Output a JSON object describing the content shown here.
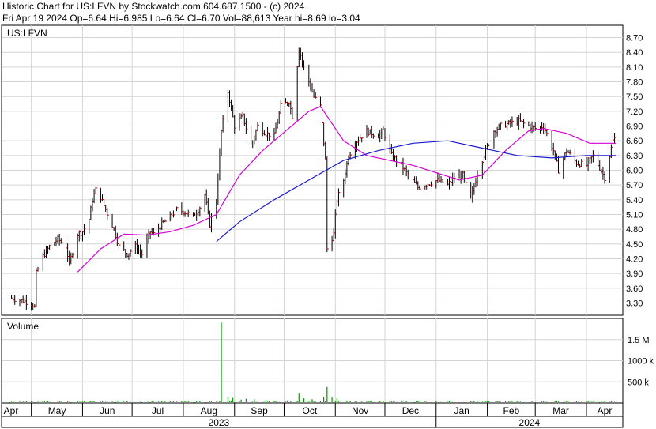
{
  "header": {
    "line1": "Historic Chart for US:LFVN by Stockwatch.com 604.687.1500 - (c) 2024",
    "line2": "Fri Apr 19 2024   Op=6.64   Hi=6.985   Lo=6.64   Cl=6.70   Vol=88,613   Year hi=8.69   lo=3.04"
  },
  "chart_data": [
    {
      "type": "line",
      "title": "US:LFVN",
      "price_axis": {
        "ticks": [
          "8.70",
          "8.40",
          "8.10",
          "7.80",
          "7.50",
          "7.20",
          "6.90",
          "6.60",
          "6.30",
          "6.00",
          "5.70",
          "5.40",
          "5.10",
          "4.80",
          "4.50",
          "4.20",
          "3.90",
          "3.60",
          "3.30"
        ],
        "ylim": [
          3.05,
          8.95
        ],
        "grid": true
      },
      "x_axis": {
        "months": [
          "Apr",
          "May",
          "Jun",
          "Jul",
          "Aug",
          "Sep",
          "Oct",
          "Nov",
          "Dec",
          "Jan",
          "Feb",
          "Mar",
          "Apr"
        ],
        "years": [
          "2023",
          "2024"
        ]
      },
      "series": [
        {
          "name": "Price",
          "style": "OHLC bars",
          "color": "#000000",
          "close_tick_color": "#cc0000",
          "points": [
            [
              "2023-04-19",
              3.4
            ],
            [
              "2023-04-26",
              3.34
            ],
            [
              "2023-05-01",
              3.3
            ],
            [
              "2023-05-03",
              3.22
            ],
            [
              "2023-05-04",
              3.9
            ],
            [
              "2023-05-08",
              4.25
            ],
            [
              "2023-05-12",
              4.45
            ],
            [
              "2023-05-17",
              4.6
            ],
            [
              "2023-05-22",
              4.45
            ],
            [
              "2023-05-24",
              4.1
            ],
            [
              "2023-05-29",
              4.7
            ],
            [
              "2023-06-01",
              4.75
            ],
            [
              "2023-06-05",
              5.0
            ],
            [
              "2023-06-07",
              5.4
            ],
            [
              "2023-06-09",
              5.6
            ],
            [
              "2023-06-12",
              5.45
            ],
            [
              "2023-06-15",
              5.2
            ],
            [
              "2023-06-20",
              4.8
            ],
            [
              "2023-06-23",
              4.45
            ],
            [
              "2023-06-28",
              4.3
            ],
            [
              "2023-07-03",
              4.45
            ],
            [
              "2023-07-07",
              4.3
            ],
            [
              "2023-07-12",
              4.75
            ],
            [
              "2023-07-14",
              4.7
            ],
            [
              "2023-07-19",
              4.9
            ],
            [
              "2023-07-24",
              5.05
            ],
            [
              "2023-07-28",
              5.2
            ],
            [
              "2023-08-02",
              5.15
            ],
            [
              "2023-08-07",
              5.05
            ],
            [
              "2023-08-11",
              5.25
            ],
            [
              "2023-08-14",
              5.5
            ],
            [
              "2023-08-17",
              4.9
            ],
            [
              "2023-08-21",
              5.4
            ],
            [
              "2023-08-24",
              6.8
            ],
            [
              "2023-08-28",
              7.6
            ],
            [
              "2023-09-01",
              6.9
            ],
            [
              "2023-09-06",
              7.1
            ],
            [
              "2023-09-11",
              6.5
            ],
            [
              "2023-09-15",
              6.9
            ],
            [
              "2023-09-20",
              6.75
            ],
            [
              "2023-09-25",
              6.7
            ],
            [
              "2023-09-29",
              7.3
            ],
            [
              "2023-10-04",
              7.4
            ],
            [
              "2023-10-06",
              7.1
            ],
            [
              "2023-10-10",
              8.5
            ],
            [
              "2023-10-12",
              8.2
            ],
            [
              "2023-10-16",
              7.8
            ],
            [
              "2023-10-19",
              7.5
            ],
            [
              "2023-10-23",
              7.3
            ],
            [
              "2023-10-26",
              6.2
            ],
            [
              "2023-10-27",
              4.4
            ],
            [
              "2023-10-31",
              4.7
            ],
            [
              "2023-11-02",
              5.4
            ],
            [
              "2023-11-06",
              5.8
            ],
            [
              "2023-11-09",
              6.3
            ],
            [
              "2023-11-14",
              6.6
            ],
            [
              "2023-11-20",
              6.8
            ],
            [
              "2023-11-27",
              6.7
            ],
            [
              "2023-11-30",
              6.8
            ],
            [
              "2023-12-05",
              6.3
            ],
            [
              "2023-12-11",
              6.1
            ],
            [
              "2023-12-15",
              5.9
            ],
            [
              "2023-12-21",
              5.65
            ],
            [
              "2024-01-02",
              5.8
            ],
            [
              "2024-01-08",
              5.7
            ],
            [
              "2024-01-12",
              5.85
            ],
            [
              "2024-01-17",
              5.9
            ],
            [
              "2024-01-22",
              5.4
            ],
            [
              "2024-01-26",
              5.95
            ],
            [
              "2024-01-31",
              6.4
            ],
            [
              "2024-02-05",
              6.8
            ],
            [
              "2024-02-09",
              6.9
            ],
            [
              "2024-02-14",
              6.95
            ],
            [
              "2024-02-20",
              7.0
            ],
            [
              "2024-02-26",
              6.9
            ],
            [
              "2024-03-01",
              6.85
            ],
            [
              "2024-03-06",
              6.9
            ],
            [
              "2024-03-12",
              6.4
            ],
            [
              "2024-03-15",
              6.0
            ],
            [
              "2024-03-20",
              6.4
            ],
            [
              "2024-03-26",
              6.15
            ],
            [
              "2024-04-01",
              6.1
            ],
            [
              "2024-04-05",
              6.3
            ],
            [
              "2024-04-09",
              6.05
            ],
            [
              "2024-04-12",
              5.85
            ],
            [
              "2024-04-17",
              6.6
            ],
            [
              "2024-04-19",
              6.7
            ]
          ]
        },
        {
          "name": "MA short",
          "color": "#d400d4",
          "points": [
            [
              "2023-05-29",
              3.93
            ],
            [
              "2023-06-12",
              4.4
            ],
            [
              "2023-06-26",
              4.7
            ],
            [
              "2023-07-10",
              4.68
            ],
            [
              "2023-07-24",
              4.75
            ],
            [
              "2023-08-07",
              4.88
            ],
            [
              "2023-08-21",
              5.1
            ],
            [
              "2023-09-04",
              5.9
            ],
            [
              "2023-09-18",
              6.4
            ],
            [
              "2023-10-02",
              6.8
            ],
            [
              "2023-10-16",
              7.2
            ],
            [
              "2023-10-23",
              7.3
            ],
            [
              "2023-11-06",
              6.6
            ],
            [
              "2023-11-20",
              6.3
            ],
            [
              "2023-12-04",
              6.2
            ],
            [
              "2023-12-18",
              6.1
            ],
            [
              "2024-01-01",
              5.95
            ],
            [
              "2024-01-15",
              5.8
            ],
            [
              "2024-01-29",
              5.9
            ],
            [
              "2024-02-12",
              6.4
            ],
            [
              "2024-02-26",
              6.8
            ],
            [
              "2024-03-06",
              6.85
            ],
            [
              "2024-03-20",
              6.75
            ],
            [
              "2024-04-03",
              6.55
            ],
            [
              "2024-04-19",
              6.55
            ]
          ]
        },
        {
          "name": "MA long",
          "color": "#1a1ad0",
          "points": [
            [
              "2023-08-21",
              4.55
            ],
            [
              "2023-09-04",
              4.95
            ],
            [
              "2023-09-25",
              5.4
            ],
            [
              "2023-10-16",
              5.8
            ],
            [
              "2023-11-06",
              6.2
            ],
            [
              "2023-11-27",
              6.4
            ],
            [
              "2023-12-18",
              6.55
            ],
            [
              "2024-01-08",
              6.6
            ],
            [
              "2024-01-29",
              6.45
            ],
            [
              "2024-02-19",
              6.3
            ],
            [
              "2024-03-11",
              6.25
            ],
            [
              "2024-04-01",
              6.3
            ],
            [
              "2024-04-19",
              6.3
            ]
          ]
        }
      ]
    },
    {
      "type": "bar",
      "title": "Volume",
      "y_ticks": [
        "1.5 M",
        "1000 k",
        "500 k"
      ],
      "ylim": [
        0,
        2000000
      ],
      "color": "#009900",
      "bars": [
        [
          "2023-04-21",
          25000
        ],
        [
          "2023-05-05",
          30000
        ],
        [
          "2023-05-19",
          28000
        ],
        [
          "2023-06-02",
          35000
        ],
        [
          "2023-06-16",
          30000
        ],
        [
          "2023-06-30",
          25000
        ],
        [
          "2023-07-14",
          27000
        ],
        [
          "2023-07-28",
          30000
        ],
        [
          "2023-08-11",
          40000
        ],
        [
          "2023-08-24",
          1900000
        ],
        [
          "2023-08-28",
          140000
        ],
        [
          "2023-08-31",
          120000
        ],
        [
          "2023-09-05",
          80000
        ],
        [
          "2023-09-08",
          100000
        ],
        [
          "2023-09-13",
          90000
        ],
        [
          "2023-09-20",
          70000
        ],
        [
          "2023-10-03",
          60000
        ],
        [
          "2023-10-10",
          220000
        ],
        [
          "2023-10-13",
          110000
        ],
        [
          "2023-10-18",
          90000
        ],
        [
          "2023-10-25",
          150000
        ],
        [
          "2023-10-27",
          380000
        ],
        [
          "2023-10-30",
          130000
        ],
        [
          "2023-11-02",
          110000
        ],
        [
          "2023-11-08",
          60000
        ],
        [
          "2023-11-21",
          40000
        ],
        [
          "2023-12-06",
          30000
        ],
        [
          "2023-12-20",
          35000
        ],
        [
          "2024-01-10",
          30000
        ],
        [
          "2024-01-24",
          45000
        ],
        [
          "2024-02-07",
          40000
        ],
        [
          "2024-02-21",
          30000
        ],
        [
          "2024-03-06",
          35000
        ],
        [
          "2024-03-20",
          40000
        ],
        [
          "2024-04-05",
          30000
        ],
        [
          "2024-04-17",
          35000
        ]
      ]
    }
  ]
}
